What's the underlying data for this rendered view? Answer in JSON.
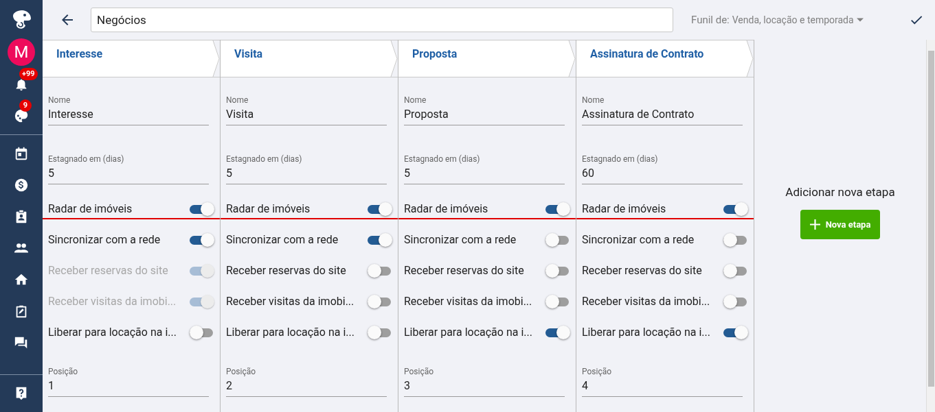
{
  "sidebar": {
    "avatar": "M",
    "badges": [
      {
        "kind": "bell",
        "count": "+99"
      },
      {
        "kind": "palette",
        "count": "9"
      }
    ],
    "items": [
      {
        "kind": "calendar"
      },
      {
        "kind": "dollar"
      },
      {
        "kind": "contact"
      },
      {
        "kind": "people"
      },
      {
        "kind": "home"
      },
      {
        "kind": "edit"
      },
      {
        "kind": "chat"
      }
    ],
    "footer": {
      "kind": "help"
    }
  },
  "toolbar": {
    "title": "Negócios",
    "funnel_label": "Funil de:",
    "funnel_value": "Venda, locação e temporada"
  },
  "stages": [
    {
      "title": "Interesse",
      "name": {
        "label": "Nome",
        "value": "Interesse"
      },
      "stagnation": {
        "label": "Estagnado em (dias)",
        "value": "5"
      },
      "toggles": [
        {
          "label": "Radar de imóveis",
          "on": true,
          "disabled": false
        },
        {
          "label": "Sincronizar com a rede",
          "on": true,
          "disabled": false
        },
        {
          "label": "Receber reservas do site",
          "on": true,
          "disabled": true
        },
        {
          "label": "Receber visitas da imobi...",
          "on": true,
          "disabled": true
        },
        {
          "label": "Liberar para locação na i...",
          "on": false,
          "disabled": false
        }
      ],
      "position": {
        "label": "Posição",
        "value": "1"
      }
    },
    {
      "title": "Visita",
      "name": {
        "label": "Nome",
        "value": "Visita"
      },
      "stagnation": {
        "label": "Estagnado em (dias)",
        "value": "5"
      },
      "toggles": [
        {
          "label": "Radar de imóveis",
          "on": true,
          "disabled": false
        },
        {
          "label": "Sincronizar com a rede",
          "on": true,
          "disabled": false
        },
        {
          "label": "Receber reservas do site",
          "on": false,
          "disabled": false
        },
        {
          "label": "Receber visitas da imobi...",
          "on": false,
          "disabled": false
        },
        {
          "label": "Liberar para locação na i...",
          "on": false,
          "disabled": false
        }
      ],
      "position": {
        "label": "Posição",
        "value": "2"
      }
    },
    {
      "title": "Proposta",
      "name": {
        "label": "Nome",
        "value": "Proposta"
      },
      "stagnation": {
        "label": "Estagnado em (dias)",
        "value": "5"
      },
      "toggles": [
        {
          "label": "Radar de imóveis",
          "on": true,
          "disabled": false
        },
        {
          "label": "Sincronizar com a rede",
          "on": false,
          "disabled": false
        },
        {
          "label": "Receber reservas do site",
          "on": false,
          "disabled": false
        },
        {
          "label": "Receber visitas da imobi...",
          "on": false,
          "disabled": false
        },
        {
          "label": "Liberar para locação na i...",
          "on": true,
          "disabled": false
        }
      ],
      "position": {
        "label": "Posição",
        "value": "3"
      }
    },
    {
      "title": "Assinatura de Contrato",
      "name": {
        "label": "Nome",
        "value": "Assinatura de Contrato"
      },
      "stagnation": {
        "label": "Estagnado em (dias)",
        "value": "60"
      },
      "toggles": [
        {
          "label": "Radar de imóveis",
          "on": true,
          "disabled": false
        },
        {
          "label": "Sincronizar com a rede",
          "on": false,
          "disabled": false
        },
        {
          "label": "Receber reservas do site",
          "on": false,
          "disabled": false
        },
        {
          "label": "Receber visitas da imobi...",
          "on": false,
          "disabled": false
        },
        {
          "label": "Liberar para locação na i...",
          "on": true,
          "disabled": false
        }
      ],
      "position": {
        "label": "Posição",
        "value": "4"
      }
    }
  ],
  "add_stage": {
    "title": "Adicionar nova etapa",
    "button": "Nova etapa"
  }
}
